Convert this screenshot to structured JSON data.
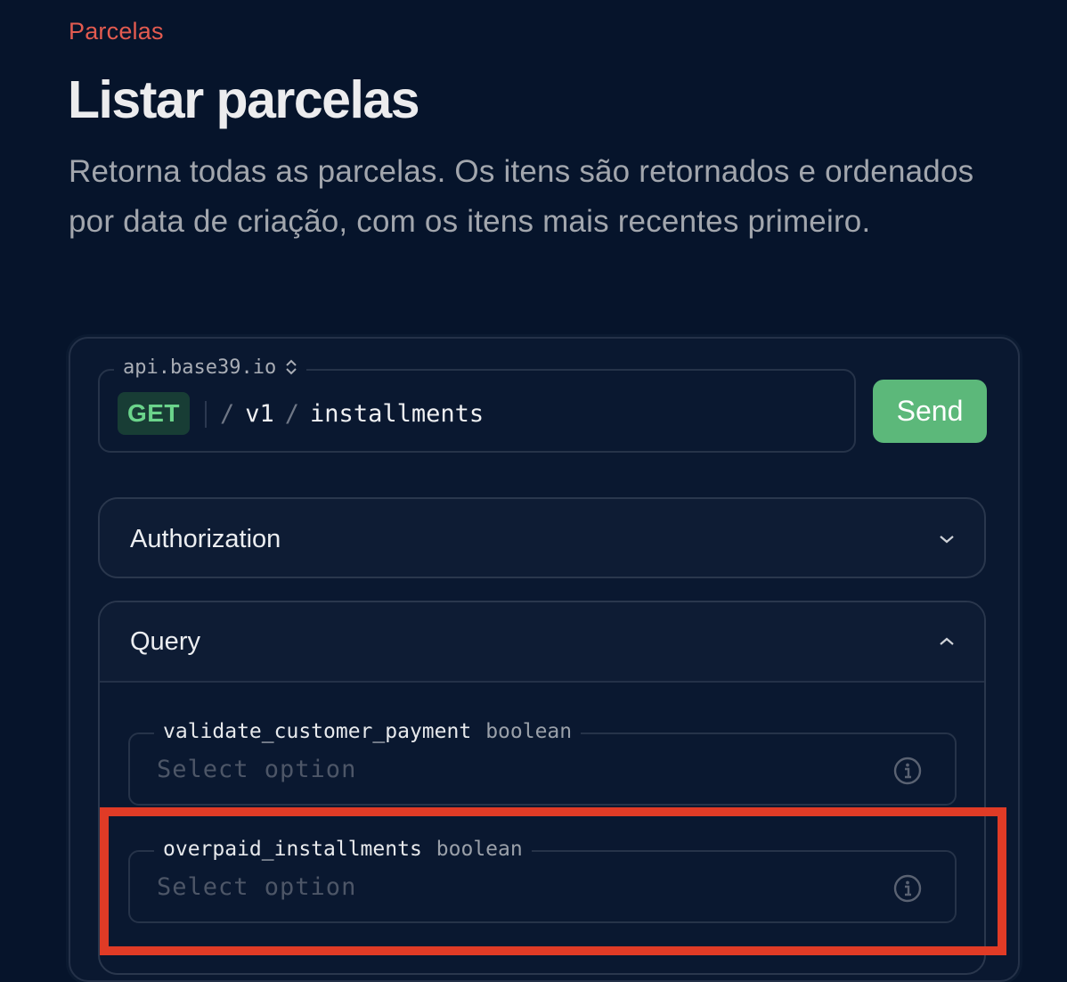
{
  "page": {
    "eyebrow": "Parcelas",
    "title": "Listar parcelas",
    "description": "Retorna todas as parcelas. Os itens são retornados e ordenados por data de criação, com os itens mais recentes primeiro."
  },
  "request": {
    "server": "api.base39.io",
    "server_icon": "chevron-up-down-icon",
    "method": "GET",
    "path_segments": [
      "v1",
      "installments"
    ],
    "path_separator": "/",
    "send_label": "Send"
  },
  "sections": {
    "authorization": {
      "label": "Authorization",
      "expanded": false
    },
    "query": {
      "label": "Query",
      "expanded": true,
      "params": [
        {
          "name": "validate_customer_payment",
          "type": "boolean",
          "placeholder": "Select option"
        },
        {
          "name": "overpaid_installments",
          "type": "boolean",
          "placeholder": "Select option"
        }
      ]
    }
  },
  "colors": {
    "background": "#06142b",
    "eyebrow": "#e35b50",
    "method_get": "#6bd48b",
    "send_button": "#5cb87a",
    "highlight_box": "#e03b26"
  }
}
